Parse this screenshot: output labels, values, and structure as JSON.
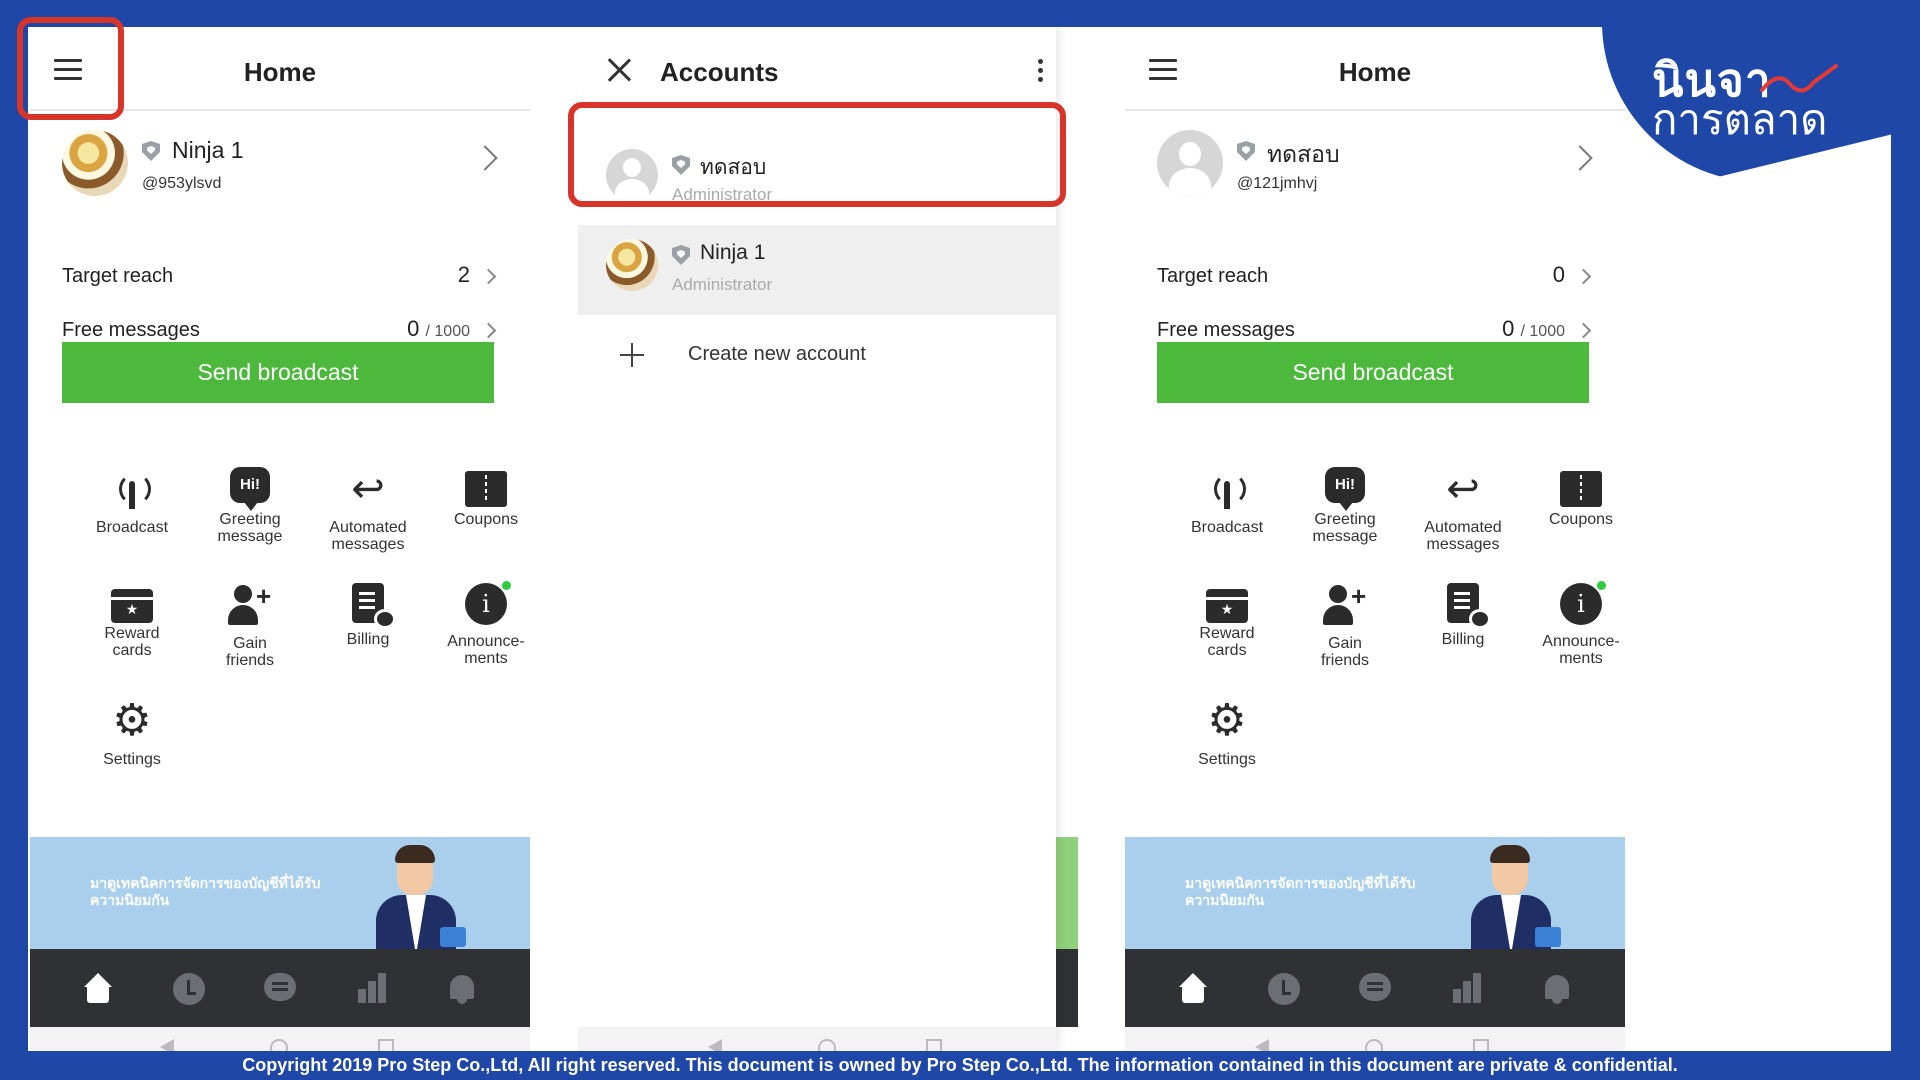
{
  "left_panel": {
    "title": "Home",
    "profile": {
      "name": "Ninja 1",
      "id": "@953ylsvd"
    },
    "target_reach": {
      "label": "Target reach",
      "value": "2"
    },
    "free_messages": {
      "label": "Free messages",
      "value": "0",
      "total": "/ 1000"
    },
    "broadcast_button": "Send broadcast",
    "tiles": {
      "broadcast": "Broadcast",
      "greeting": "Greeting\nmessage",
      "automated": "Automated\nmessages",
      "coupons": "Coupons",
      "reward": "Reward\ncards",
      "gain": "Gain\nfriends",
      "billing": "Billing",
      "announcements": "Announce-\nments",
      "settings": "Settings"
    },
    "banner_text": "มาดูเทคนิคการจัดการของบัญชีที่ได้รับความนิยมกัน",
    "greeting_icon_text": "Hi!"
  },
  "mid_panel": {
    "title": "Accounts",
    "accounts": [
      {
        "name": "ทดสอบ",
        "role": "Administrator"
      },
      {
        "name": "Ninja 1",
        "role": "Administrator"
      }
    ],
    "create_label": "Create new account"
  },
  "right_panel": {
    "title": "Home",
    "profile": {
      "name": "ทดสอบ",
      "id": "@121jmhvj"
    },
    "target_reach": {
      "label": "Target reach",
      "value": "0"
    },
    "free_messages": {
      "label": "Free messages",
      "value": "0",
      "total": "/ 1000"
    },
    "broadcast_button": "Send broadcast",
    "tiles": {
      "broadcast": "Broadcast",
      "greeting": "Greeting\nmessage",
      "automated": "Automated\nmessages",
      "coupons": "Coupons",
      "reward": "Reward\ncards",
      "gain": "Gain\nfriends",
      "billing": "Billing",
      "announcements": "Announce-\nments",
      "settings": "Settings"
    },
    "banner_text": "มาดูเทคนิคการจัดการของบัญชีที่ได้รับความนิยมกัน",
    "greeting_icon_text": "Hi!"
  },
  "logo": {
    "line1": "นินจา",
    "line2": "การตลาด"
  },
  "footer": "Copyright 2019 Pro Step Co.,Ltd, All right reserved. This document is owned by Pro Step Co.,Ltd. The information contained in this document are private & confidential.",
  "colors": {
    "brand_blue": "#1e47a8",
    "broadcast_green": "#4cb83c",
    "highlight_red": "#d8352a",
    "nav_dark": "#2f3134"
  }
}
